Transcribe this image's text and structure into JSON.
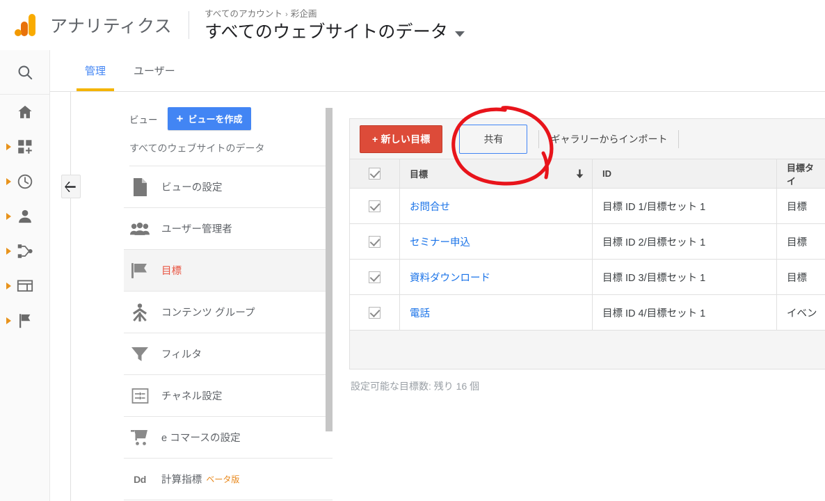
{
  "header": {
    "brand": "アナリティクス",
    "logo_colors": {
      "dot": "#f29900",
      "bar_mid": "#e8710a",
      "bar_tall": "#f9ab00"
    },
    "breadcrumb_account": "すべてのアカウント",
    "breadcrumb_separator": "›",
    "breadcrumb_property": "彩企画",
    "property_title": "すべてのウェブサイトのデータ",
    "caret_icon": "chevron-down-icon"
  },
  "rail": {
    "search_icon": "search-icon",
    "items": [
      {
        "icon": "home-icon",
        "expandable": false
      },
      {
        "icon": "customization-add-icon",
        "expandable": true
      },
      {
        "icon": "realtime-clock-icon",
        "expandable": true
      },
      {
        "icon": "audience-person-icon",
        "expandable": true
      },
      {
        "icon": "acquisition-share-icon",
        "expandable": true
      },
      {
        "icon": "behavior-window-icon",
        "expandable": true
      },
      {
        "icon": "conversions-flag-icon",
        "expandable": true
      }
    ]
  },
  "tabs": [
    {
      "label": "管理",
      "active": true
    },
    {
      "label": "ユーザー",
      "active": false
    }
  ],
  "collapse_button": {
    "icon": "arrow-left-icon"
  },
  "view_column": {
    "label": "ビュー",
    "create_button": {
      "plus": "+",
      "label": "ビューを作成"
    },
    "current_view": "すべてのウェブサイトのデータ",
    "menu": [
      {
        "icon": "document-icon",
        "label": "ビューの設定",
        "active": false
      },
      {
        "icon": "people-icon",
        "label": "ユーザー管理者",
        "active": false
      },
      {
        "icon": "flag-icon",
        "label": "目標",
        "active": true
      },
      {
        "icon": "content-grouping-icon",
        "label": "コンテンツ グループ",
        "active": false
      },
      {
        "icon": "funnel-filter-icon",
        "label": "フィルタ",
        "active": false
      },
      {
        "icon": "channel-settings-icon",
        "label": "チャネル設定",
        "active": false
      },
      {
        "icon": "shopping-cart-icon",
        "label": "e コマースの設定",
        "active": false
      },
      {
        "icon": "dd-calculated-metrics-icon",
        "label": "計算指標",
        "badge": "ベータ版",
        "active": false
      }
    ]
  },
  "toolbar": {
    "new_goal_label": "+ 新しい目標",
    "share_label": "共有",
    "import_label": "ギャラリーからインポート"
  },
  "table": {
    "columns": [
      "目標",
      "ID",
      "目標タイ"
    ],
    "sort_icon": "sort-descending-arrow-icon",
    "header_checkbox": true,
    "rows": [
      {
        "checked": true,
        "goal": "お問合せ",
        "id": "目標 ID 1/目標セット 1",
        "type": "目標"
      },
      {
        "checked": true,
        "goal": "セミナー申込",
        "id": "目標 ID 2/目標セット 1",
        "type": "目標"
      },
      {
        "checked": true,
        "goal": "資料ダウンロード",
        "id": "目標 ID 3/目標セット 1",
        "type": "目標"
      },
      {
        "checked": true,
        "goal": "電話",
        "id": "目標 ID 4/目標セット 1",
        "type": "イベン"
      }
    ]
  },
  "footer_note": "設定可能な目標数: 残り 16 個",
  "annotation": {
    "type": "hand-drawn-circle",
    "color": "#e8141b",
    "target": "共有"
  },
  "colors": {
    "accent_blue": "#4285f4",
    "link_blue": "#1a73e8",
    "red_button": "#dd4b39",
    "active_orange": "#e8523f",
    "tab_underline": "#f4b400"
  }
}
